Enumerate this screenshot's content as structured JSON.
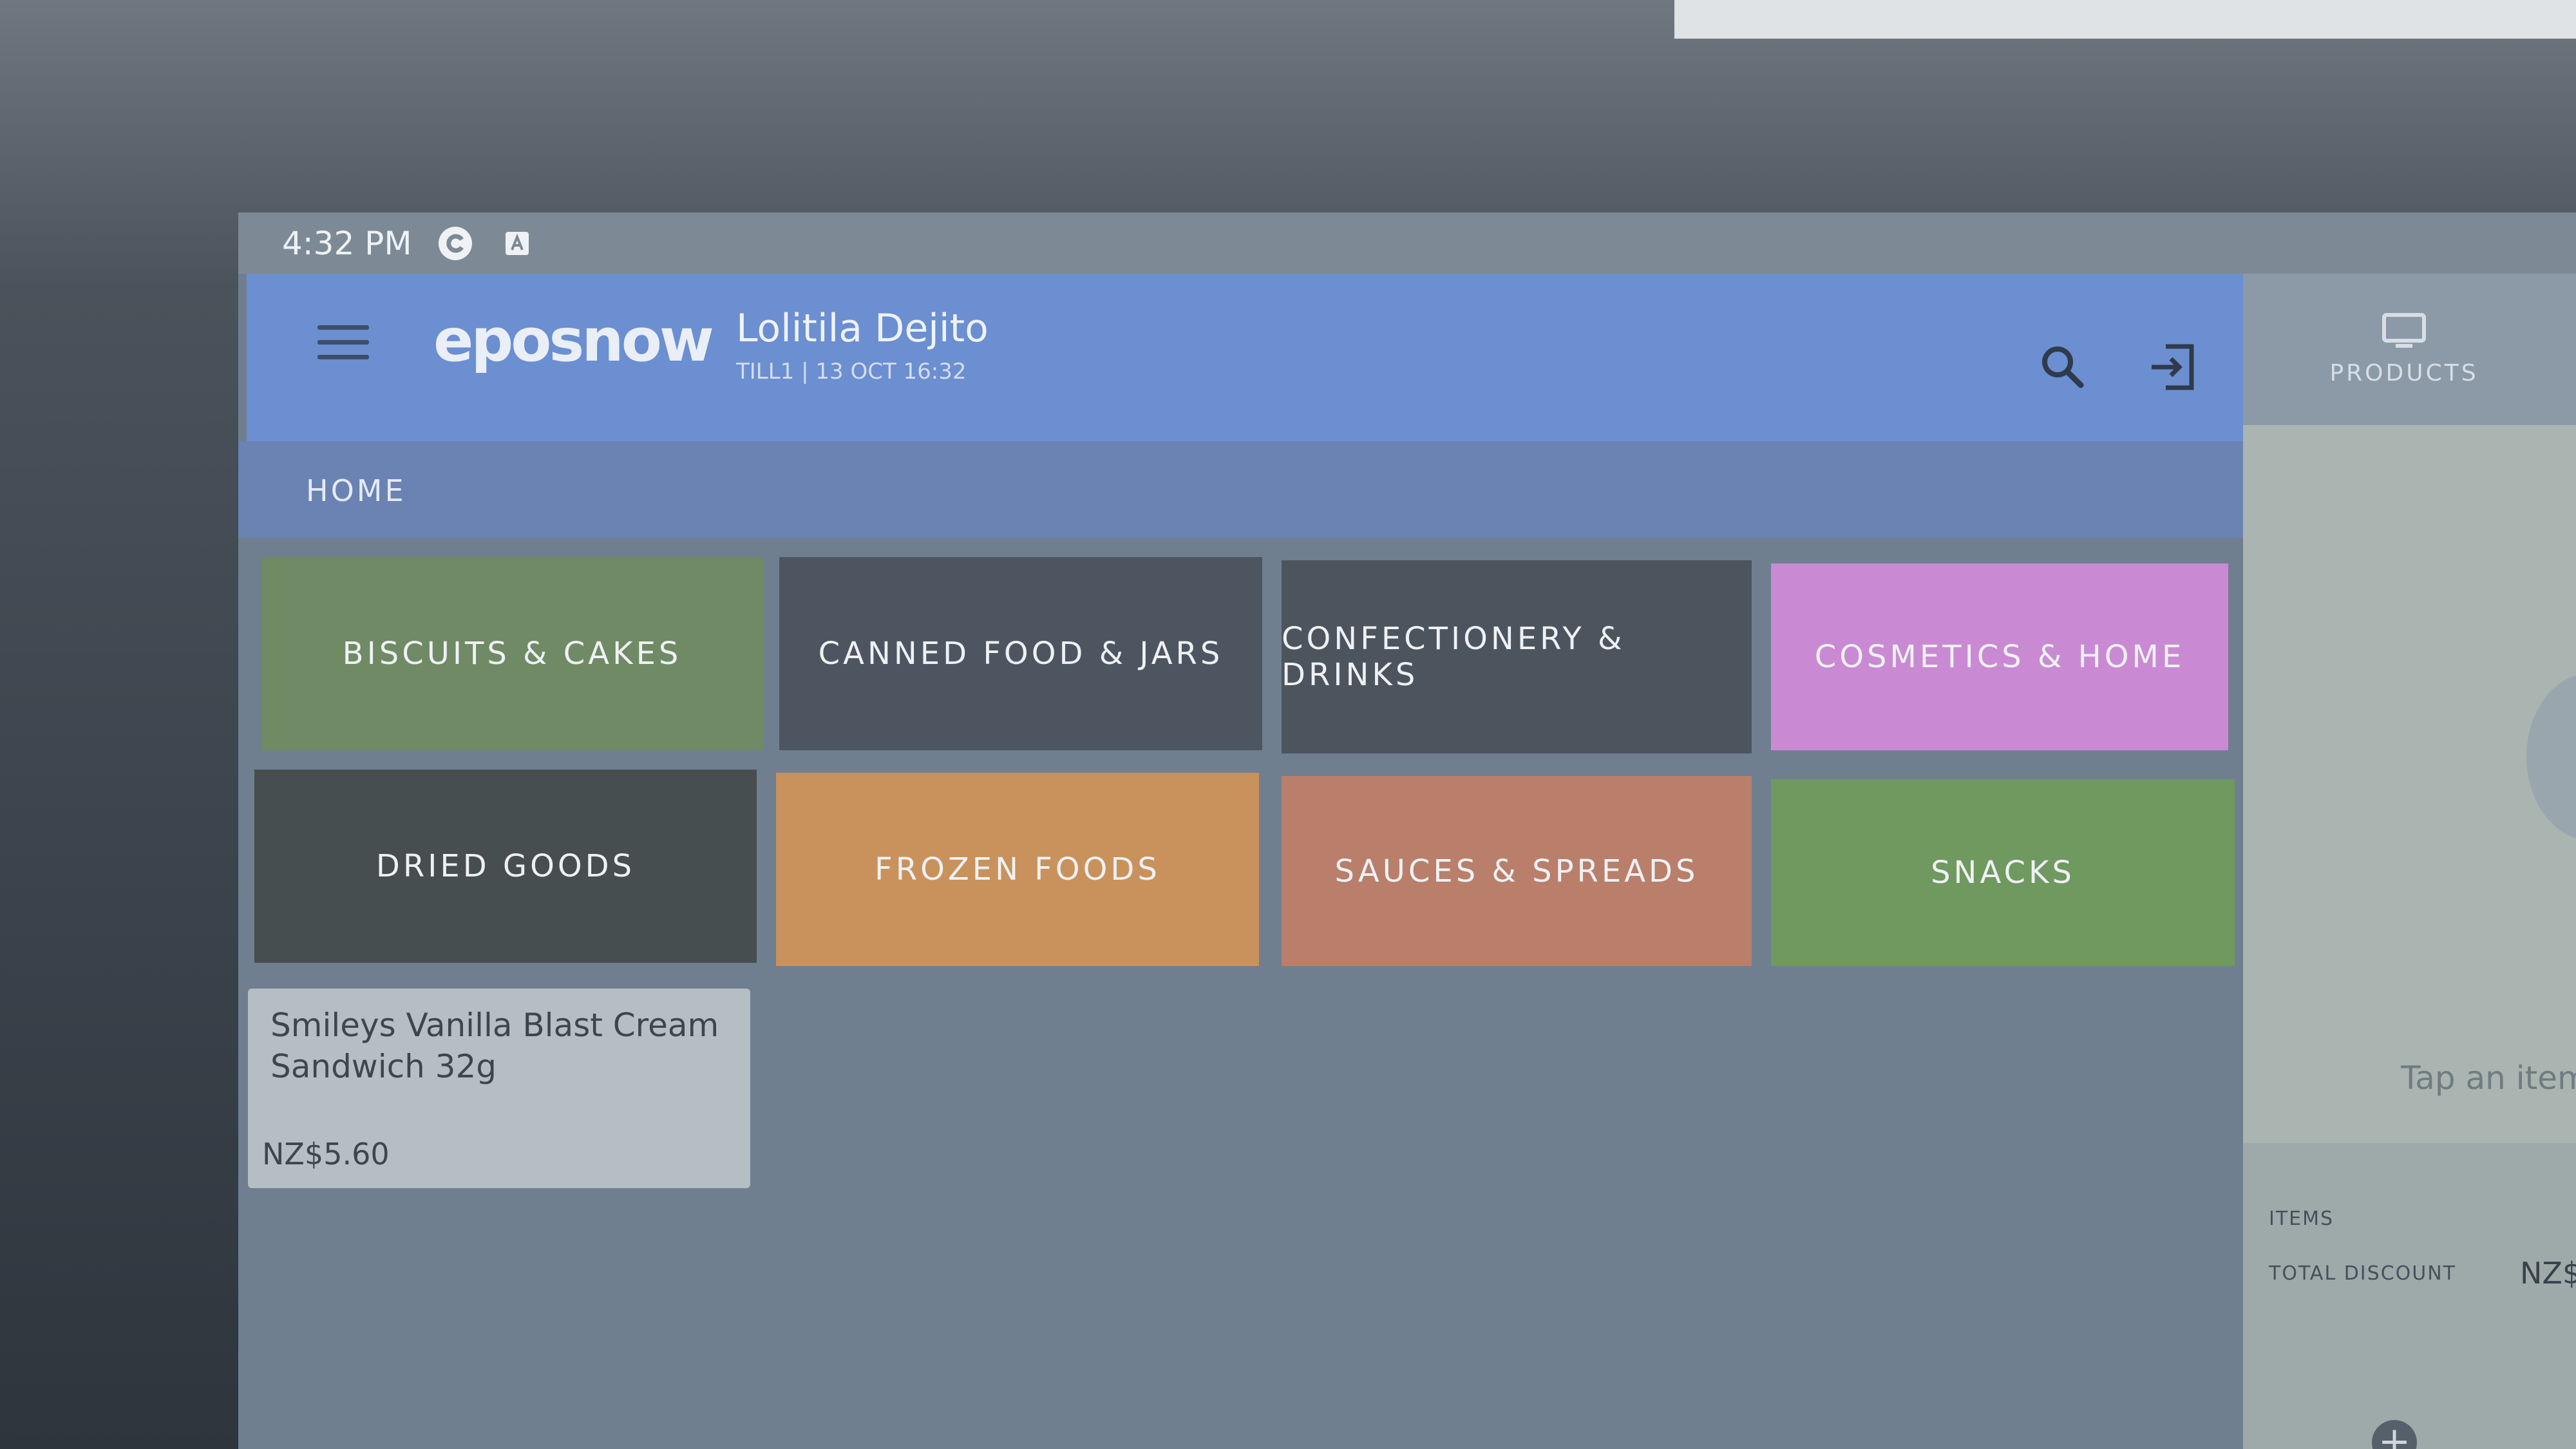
{
  "status_bar": {
    "time": "4:32 PM"
  },
  "header": {
    "logo": "eposnow",
    "user_name": "Lolitila Dejito",
    "till_info": "TILL1 | 13 OCT 16:32",
    "icons": [
      "menu-icon",
      "search-icon",
      "logout-icon"
    ]
  },
  "breadcrumb": {
    "home": "HOME"
  },
  "categories": [
    {
      "label": "BISCUITS & CAKES",
      "color": "#6f8a64"
    },
    {
      "label": "CANNED FOOD & JARS",
      "color": "#4d5660"
    },
    {
      "label": "CONFECTIONERY & DRINKS",
      "color": "#4c545d"
    },
    {
      "label": "COSMETICS & HOME",
      "color": "#c98ad3"
    },
    {
      "label": "DRIED GOODS",
      "color": "#464e4f"
    },
    {
      "label": "FROZEN FOODS",
      "color": "#c9925c"
    },
    {
      "label": "SAUCES & SPREADS",
      "color": "#b97f6a"
    },
    {
      "label": "SNACKS",
      "color": "#6f995f"
    }
  ],
  "product": {
    "name": "Smileys Vanilla Blast Cream Sandwich 32g",
    "price": "NZ$5.60"
  },
  "right_panel": {
    "tab_label": "PRODUCTS",
    "tap_hint": "Tap an item",
    "items_label": "ITEMS",
    "discount_label": "TOTAL DISCOUNT",
    "discount_value": "NZ$"
  }
}
